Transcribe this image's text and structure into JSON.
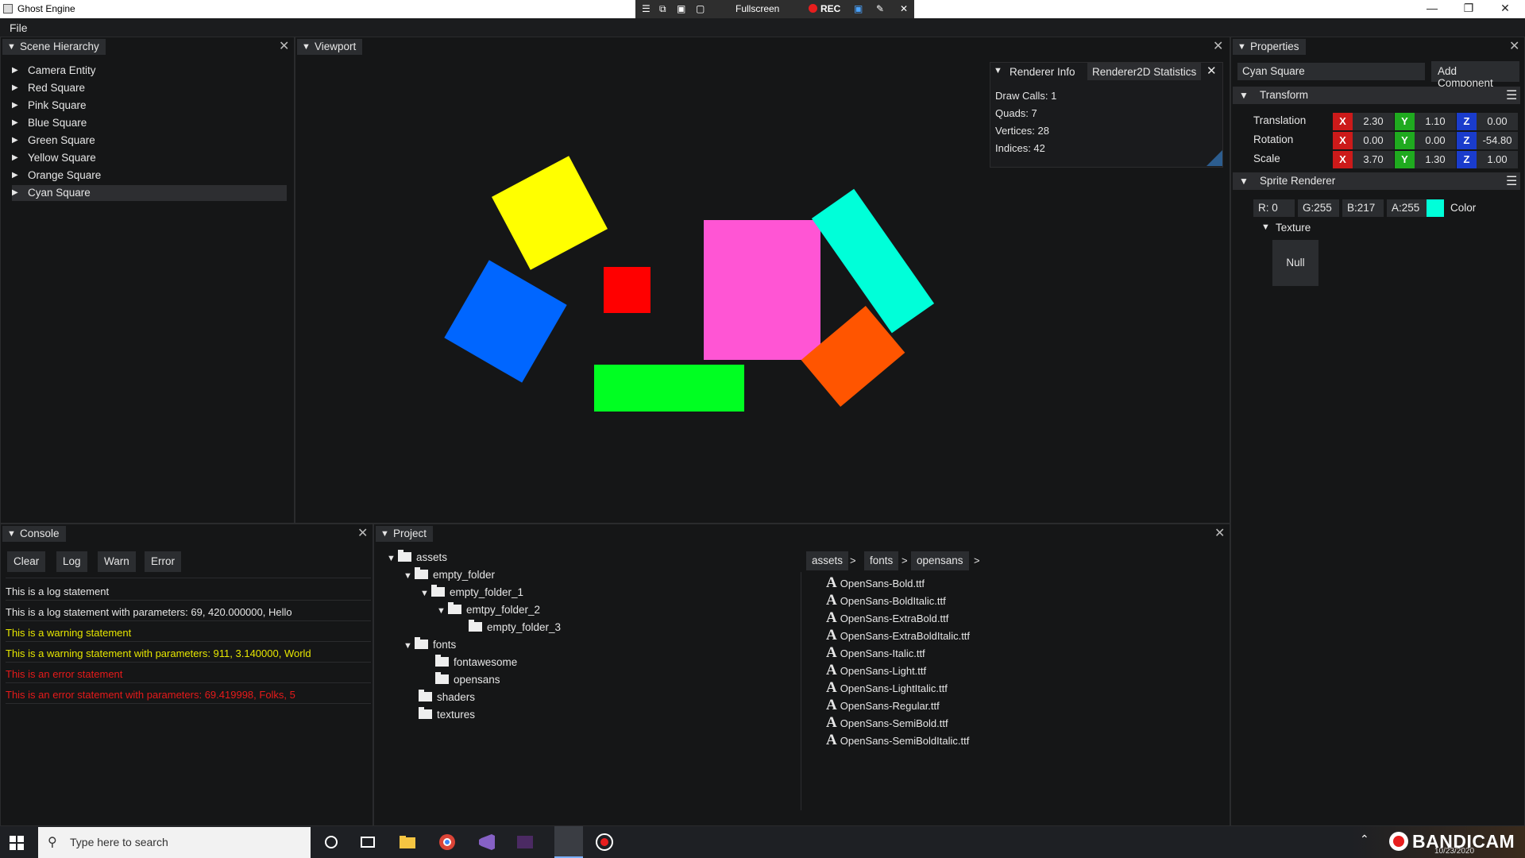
{
  "window": {
    "title": "Ghost Engine"
  },
  "recorder": {
    "fullscreen": "Fullscreen",
    "rec": "REC"
  },
  "menu": {
    "file": "File"
  },
  "hierarchy": {
    "title": "Scene Hierarchy",
    "items": [
      "Camera Entity",
      "Red Square",
      "Pink Square",
      "Blue Square",
      "Green Square",
      "Yellow Square",
      "Orange Square",
      "Cyan Square"
    ],
    "selected": "Cyan Square"
  },
  "viewport": {
    "title": "Viewport",
    "shapes": [
      {
        "name": "yellow-square",
        "color": "#ffff00"
      },
      {
        "name": "blue-square",
        "color": "#0066ff"
      },
      {
        "name": "red-square",
        "color": "#ff0000"
      },
      {
        "name": "pink-square",
        "color": "#ff55d4"
      },
      {
        "name": "cyan-square",
        "color": "#00ffd9"
      },
      {
        "name": "green-square",
        "color": "#00ff22"
      },
      {
        "name": "orange-square",
        "color": "#ff5500"
      }
    ]
  },
  "renderer": {
    "tab1": "Renderer Info",
    "tab2": "Renderer2D Statistics",
    "draw_calls": "Draw Calls: 1",
    "quads": "Quads: 7",
    "vertices": "Vertices: 28",
    "indices": "Indices: 42"
  },
  "properties": {
    "title": "Properties",
    "entity_name": "Cyan Square",
    "add_component": "Add Component",
    "transform": {
      "title": "Transform",
      "translation_label": "Translation",
      "rotation_label": "Rotation",
      "scale_label": "Scale",
      "axis_x": "X",
      "axis_y": "Y",
      "axis_z": "Z",
      "translation": [
        "2.30",
        "1.10",
        "0.00"
      ],
      "rotation": [
        "0.00",
        "0.00",
        "-54.80"
      ],
      "scale": [
        "3.70",
        "1.30",
        "1.00"
      ]
    },
    "sprite": {
      "title": "Sprite Renderer",
      "r": "R:  0",
      "g": "G:255",
      "b": "B:217",
      "a": "A:255",
      "color_label": "Color",
      "color_value": "#00ffd9",
      "texture_label": "Texture",
      "texture_value": "Null"
    }
  },
  "console": {
    "title": "Console",
    "buttons": [
      "Clear",
      "Log",
      "Warn",
      "Error"
    ],
    "lines": [
      {
        "text": "This is a log statement",
        "level": "log"
      },
      {
        "text": "This is a log statement with parameters: 69, 420.000000, Hello",
        "level": "log"
      },
      {
        "text": "This is a warning statement",
        "level": "warn"
      },
      {
        "text": "This is a warning statement with parameters: 911, 3.140000, World",
        "level": "warn"
      },
      {
        "text": "This is an error statement",
        "level": "error"
      },
      {
        "text": "This is an error statement with parameters: 69.419998, Folks, 5",
        "level": "error"
      }
    ],
    "colors": {
      "log": "#e6e6e6",
      "warn": "#e6e600",
      "error": "#e61a1a"
    }
  },
  "project": {
    "title": "Project",
    "tree": {
      "assets": "assets",
      "empty_folder": "empty_folder",
      "empty_folder_1": "empty_folder_1",
      "emtpy_folder_2": "emtpy_folder_2",
      "empty_folder_3": "empty_folder_3",
      "fonts": "fonts",
      "fontawesome": "fontawesome",
      "opensans": "opensans",
      "shaders": "shaders",
      "textures": "textures"
    },
    "breadcrumb": [
      "assets",
      "fonts",
      "opensans"
    ],
    "breadcrumb_sep": ">",
    "files": [
      "OpenSans-Bold.ttf",
      "OpenSans-BoldItalic.ttf",
      "OpenSans-ExtraBold.ttf",
      "OpenSans-ExtraBoldItalic.ttf",
      "OpenSans-Italic.ttf",
      "OpenSans-Light.ttf",
      "OpenSans-LightItalic.ttf",
      "OpenSans-Regular.ttf",
      "OpenSans-SemiBold.ttf",
      "OpenSans-SemiBoldItalic.ttf"
    ],
    "file_icon": "A"
  },
  "taskbar": {
    "search_placeholder": "Type here to search",
    "bandicam": "BANDICAM",
    "date": "10/23/2020"
  }
}
